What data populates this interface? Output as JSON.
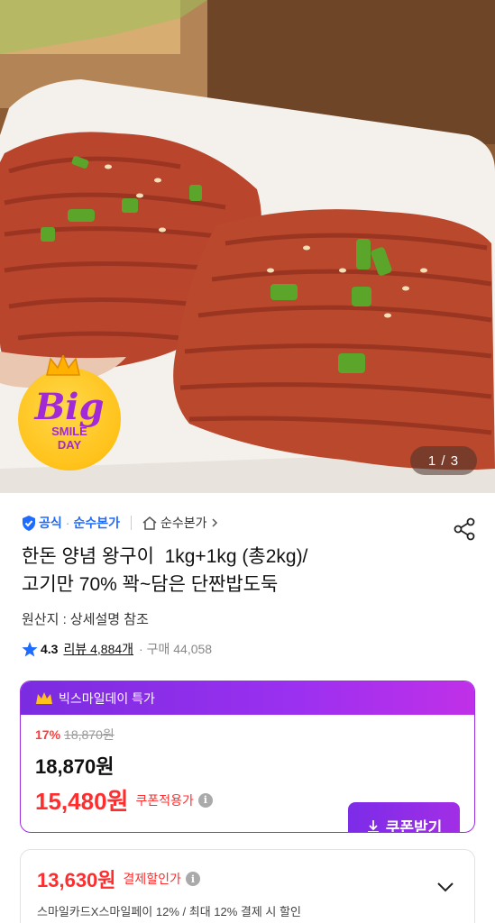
{
  "hero": {
    "page_indicator": "1 / 3",
    "badge": {
      "big": "Big",
      "line1": "SMILE",
      "line2": "DAY"
    }
  },
  "brand": {
    "official_label": "공식",
    "brand_name": "순수본가",
    "store_link": "순수본가",
    "icons": [
      "shield-check-icon",
      "home-icon",
      "chevron-right-icon",
      "share-icon"
    ]
  },
  "product": {
    "title_line1": "한돈 양념 왕구이  1kg+1kg (총2kg)/",
    "title_line2": "고기만 70% 꽉~담은 단짠밥도둑",
    "origin": "원산지 : 상세설명 참조",
    "rating": "4.3",
    "review_label": "리뷰 4,884개",
    "purchase_label": "· 구매 44,058"
  },
  "promo": {
    "header": "빅스마일데이 특가",
    "discount_pct": "17%",
    "original_price": "18,870원",
    "price": "18,870원",
    "coupon_price": "15,480원",
    "coupon_label": "쿠폰적용가",
    "coupon_button": "쿠폰받기",
    "accent_color": "#8a2ee6",
    "sale_color": "#ff2d2d"
  },
  "payment": {
    "price": "13,630원",
    "label": "결제할인가",
    "description": "스마일카드X스마일페이 12% / 최대 12% 결제 시 할인"
  }
}
